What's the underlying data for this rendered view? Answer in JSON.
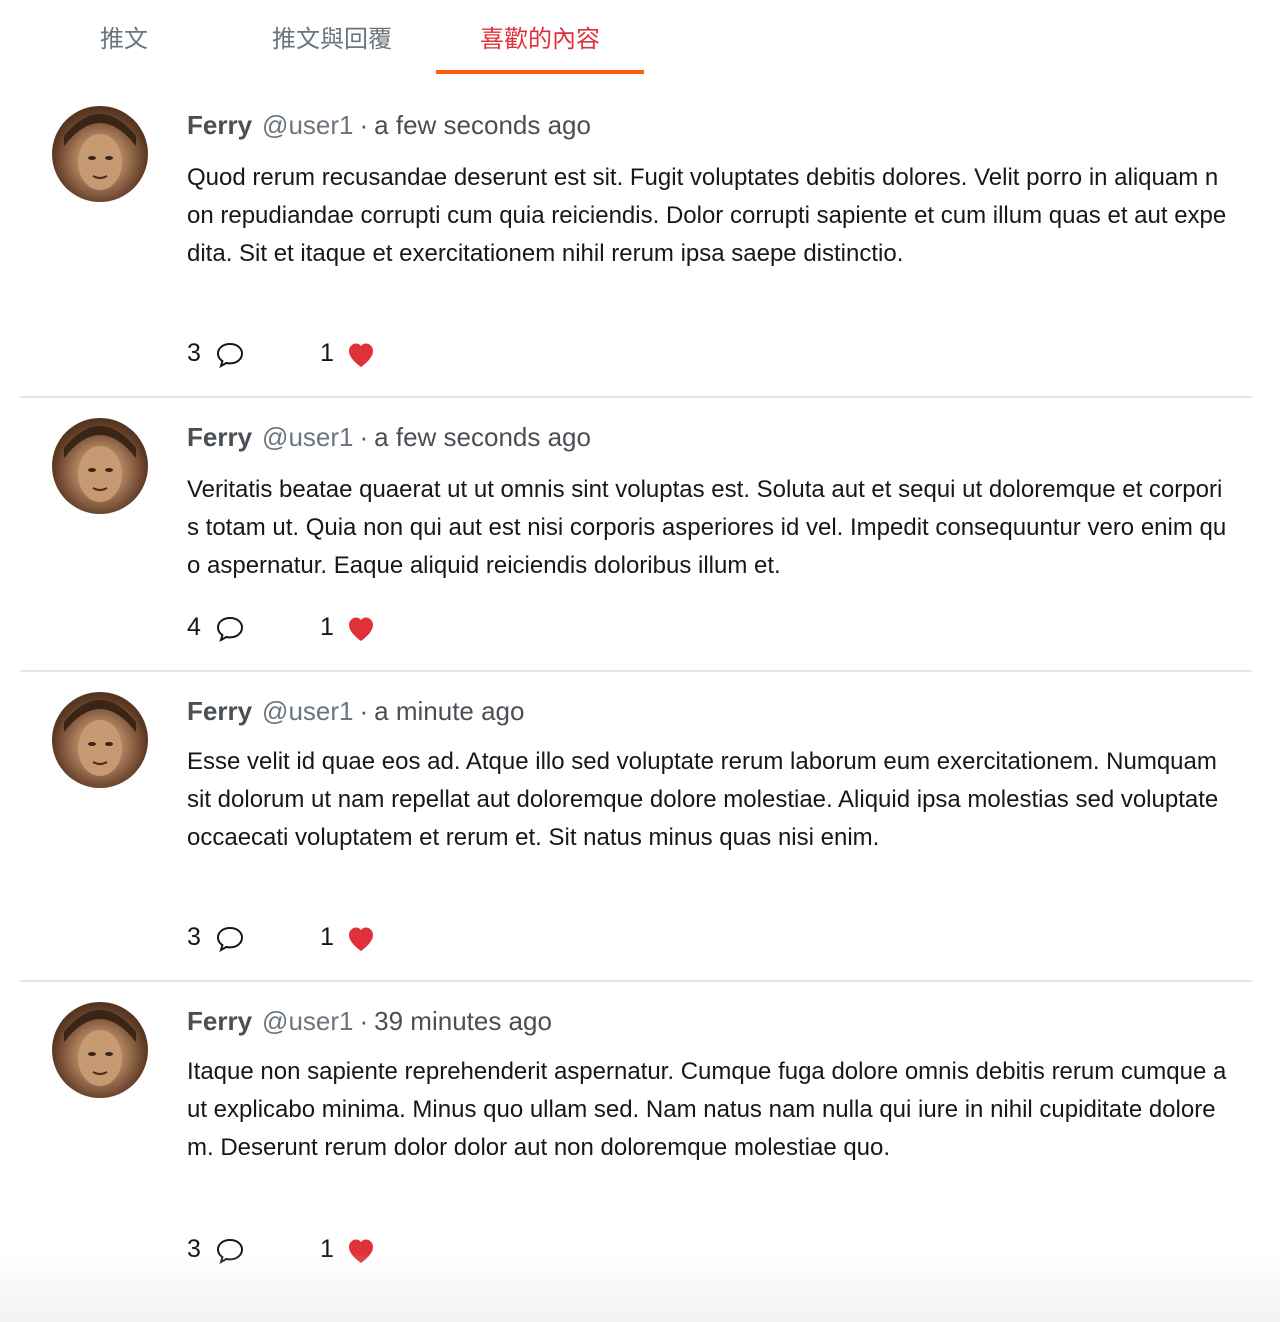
{
  "tabs": [
    {
      "label": "推文"
    },
    {
      "label": "推文與回覆"
    },
    {
      "label": "喜歡的內容"
    }
  ],
  "tweets": [
    {
      "name": "Ferry",
      "handle": "@user1",
      "separator": "·",
      "time": "a few seconds ago",
      "content": "Quod rerum recusandae deserunt est sit. Fugit voluptates debitis dolores. Velit porro in aliquam non repudiandae corrupti cum quia reiciendis. Dolor corrupti sapiente et cum illum quas et aut expedita. Sit et itaque et exercitationem nihil rerum ipsa saepe distinctio.",
      "reply_count": "3",
      "like_count": "1"
    },
    {
      "name": "Ferry",
      "handle": "@user1",
      "separator": "·",
      "time": "a few seconds ago",
      "content": "Veritatis beatae quaerat ut ut omnis sint voluptas est. Soluta aut et sequi ut doloremque et corporis totam ut. Quia non qui aut est nisi corporis asperiores id vel. Impedit consequuntur vero enim quo aspernatur. Eaque aliquid reiciendis doloribus illum et.",
      "reply_count": "4",
      "like_count": "1"
    },
    {
      "name": "Ferry",
      "handle": "@user1",
      "separator": "·",
      "time": "a minute ago",
      "content": "Esse velit id quae eos ad. Atque illo sed voluptate rerum laborum eum exercitationem. Numquam sit dolorum ut nam repellat aut doloremque dolore molestiae. Aliquid ipsa molestias sed voluptate occaecati voluptatem et rerum et. Sit natus minus quas nisi enim.",
      "reply_count": "3",
      "like_count": "1"
    },
    {
      "name": "Ferry",
      "handle": "@user1",
      "separator": "·",
      "time": "39 minutes ago",
      "content": "Itaque non sapiente reprehenderit aspernatur. Cumque fuga dolore omnis debitis rerum cumque aut explicabo minima. Minus quo ullam sed. Nam natus nam nulla qui iure in nihil cupiditate dolorem. Deserunt rerum dolor dolor aut non doloremque molestiae quo.",
      "reply_count": "3",
      "like_count": "1"
    }
  ],
  "icons": {
    "reply": "speech-bubble-outline",
    "like": "heart-filled"
  },
  "colors": {
    "active_tab": "#e0303a",
    "tab_underline": "#ff5a14",
    "heart": "#e0303a",
    "inactive_tab": "#6c757d"
  },
  "active_tab_index": 2
}
